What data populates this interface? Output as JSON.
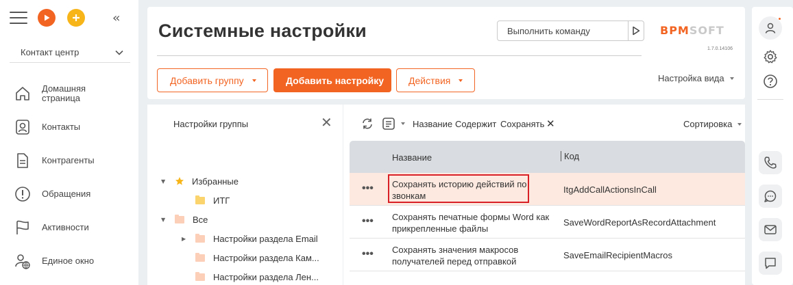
{
  "app": {
    "workspace": "Контакт центр",
    "nav": [
      {
        "label": "Домашняя страница",
        "icon": "home-icon"
      },
      {
        "label": "Контакты",
        "icon": "contact-icon"
      },
      {
        "label": "Контрагенты",
        "icon": "document-icon"
      },
      {
        "label": "Обращения",
        "icon": "alert-icon"
      },
      {
        "label": "Активности",
        "icon": "flag-icon"
      },
      {
        "label": "Единое окно",
        "icon": "user-globe-icon"
      }
    ]
  },
  "header": {
    "title": "Системные настройки",
    "command_placeholder": "Выполнить команду",
    "logo_left": "BPM",
    "logo_right": "SOFT",
    "version": "1.7.0.14106",
    "add_group_label": "Добавить группу",
    "add_setting_label": "Добавить настройку",
    "actions_label": "Действия",
    "view_setting_label": "Настройка вида"
  },
  "groups": {
    "title": "Настройки группы",
    "tree": [
      {
        "label": "Избранные",
        "expand": "▼",
        "icon": "star-icon"
      },
      {
        "label": "ИТГ",
        "expand": "",
        "icon": "folder-icon"
      },
      {
        "label": "Все",
        "expand": "▼",
        "icon": "folder-icon"
      },
      {
        "label": "Настройки раздела Email",
        "expand": "▶",
        "icon": "folder-icon"
      },
      {
        "label": "Настройки раздела Кам...",
        "expand": "",
        "icon": "folder-icon"
      },
      {
        "label": "Настройки раздела Лен...",
        "expand": "",
        "icon": "folder-icon"
      }
    ]
  },
  "filter": {
    "chip_name": "Название",
    "chip_op": "Содержит",
    "chip_value": "Сохранять",
    "sort_label": "Сортировка"
  },
  "grid": {
    "columns": {
      "name": "Название",
      "code": "Код"
    },
    "rows": [
      {
        "name": "Сохранять историю действий по звонкам",
        "code": "ItgAddCallActionsInCall",
        "selected": true
      },
      {
        "name": "Сохранять печатные формы Word как прикрепленные файлы",
        "code": "SaveWordReportAsRecordAttachment",
        "selected": false
      },
      {
        "name": "Сохранять значения макросов получателей перед отправкой",
        "code": "SaveEmailRecipientMacros",
        "selected": false
      }
    ]
  },
  "colors": {
    "accent": "#f26422",
    "highlight": "#d81f26",
    "selected_row": "#fde9df"
  }
}
